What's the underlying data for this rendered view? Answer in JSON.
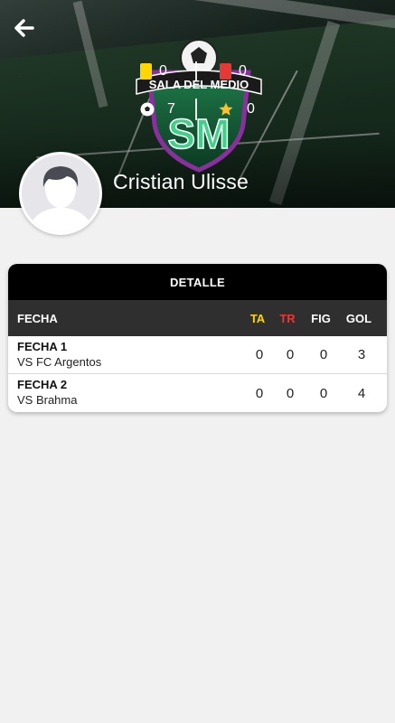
{
  "header": {
    "back_icon": "arrow-left-icon",
    "crest_text": "SALA DEL MEDIO",
    "crest_monogram": "SM",
    "player_name": "Cristian Ulisse",
    "stats": {
      "yellow_cards": "0",
      "red_cards": "0",
      "goals": "7",
      "mvp": "0"
    }
  },
  "detail": {
    "title": "DETALLE",
    "columns": {
      "fecha": "FECHA",
      "ta": "TA",
      "tr": "TR",
      "fig": "FIG",
      "gol": "GOL"
    },
    "rows": [
      {
        "fecha": "FECHA 1",
        "rival": "VS FC Argentos",
        "ta": "0",
        "tr": "0",
        "fig": "0",
        "gol": "3"
      },
      {
        "fecha": "FECHA 2",
        "rival": "VS Brahma",
        "ta": "0",
        "tr": "0",
        "fig": "0",
        "gol": "4"
      }
    ]
  },
  "colors": {
    "ta": "#ffd600",
    "tr": "#e53935",
    "crest_green": "#3fbf7f",
    "crest_purple": "#7b2a8c"
  }
}
